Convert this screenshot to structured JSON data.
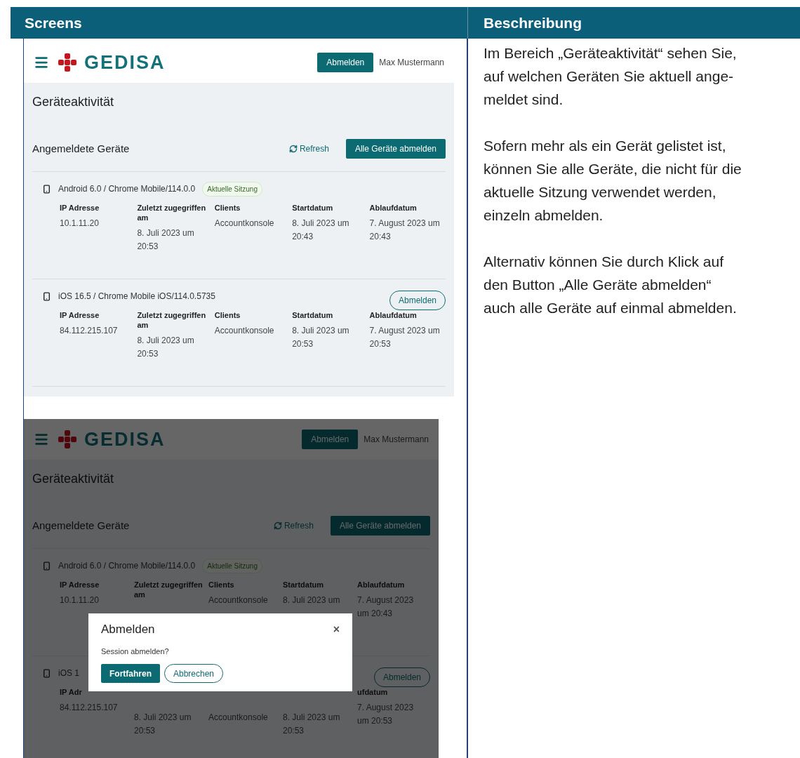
{
  "table": {
    "columns": [
      "Screens",
      "Beschreibung"
    ]
  },
  "screens": [
    {
      "dimmed": false,
      "logo": "GEDISA",
      "logout_button": "Abmelden",
      "user": "Max Mustermann",
      "page_title": "Geräteaktivität",
      "section_title": "Angemeldete Geräte",
      "refresh": "Refresh",
      "logout_all": "Alle Geräte abmelden",
      "devices": [
        {
          "name": "Android 6.0 / Chrome Mobile/114.0.0",
          "badge": "Aktuelle Sitzung",
          "cells": [
            {
              "label": "IP Adresse",
              "value": "10.1.11.20"
            },
            {
              "label": "Zuletzt zugegriffen am",
              "value": "8. Juli 2023 um 20:53"
            },
            {
              "label": "Clients",
              "value": "Accountkonsole"
            },
            {
              "label": "Startdatum",
              "value": "8. Juli 2023 um 20:43"
            },
            {
              "label": "Ablaufdatum",
              "value": "7. August 2023 um 20:43"
            }
          ]
        },
        {
          "name": "iOS 16.5 / Chrome Mobile iOS/114.0.5735",
          "logout_button": "Abmelden",
          "cells": [
            {
              "label": "IP Adresse",
              "value": "84.112.215.107"
            },
            {
              "label": "Zuletzt zugegriffen am",
              "value": "8. Juli 2023 um 20:53"
            },
            {
              "label": "Clients",
              "value": "Accountkonsole"
            },
            {
              "label": "Startdatum",
              "value": "8. Juli 2023 um 20:53"
            },
            {
              "label": "Ablaufdatum",
              "value": "7. August 2023 um 20:53"
            }
          ]
        }
      ]
    },
    {
      "dimmed": true,
      "logo": "GEDISA",
      "logout_button": "Abmelden",
      "user": "Max Mustermann",
      "page_title": "Geräteaktivität",
      "section_title": "Angemeldete Geräte",
      "refresh": "Refresh",
      "logout_all": "Alle Geräte abmelden",
      "devices": [
        {
          "name": "Android 6.0 / Chrome Mobile/114.0.0",
          "badge": "Aktuelle Sitzung",
          "cells": [
            {
              "label": "IP Adresse",
              "value": "10.1.11.20"
            },
            {
              "label": "Zuletzt zugegriffen am"
            },
            {
              "label": "Clients",
              "value": "Accountkonsole"
            },
            {
              "label": "Startdatum",
              "value": "8. Juli 2023 um"
            },
            {
              "label": "Ablaufdatum",
              "value": "7. August 2023 um 20:43"
            }
          ]
        },
        {
          "name": "iOS 1",
          "logout_button": "Abmelden",
          "cells": [
            {
              "label": "IP Adr",
              "value": "84.112.215.107"
            },
            {
              "value": "8. Juli 2023 um 20:53"
            },
            {
              "value": "Accountkonsole"
            },
            {
              "value": "8. Juli 2023 um 20:53"
            },
            {
              "label": "ufdatum",
              "value": "7. August 2023 um 20:53"
            }
          ]
        }
      ],
      "dialog": {
        "title": "Abmelden",
        "close": "×",
        "message": "Session abmelden?",
        "confirm": "Fortfahren",
        "cancel": "Abbrechen"
      }
    }
  ],
  "description": [
    "Im Bereich „Geräteaktivität“ sehen Sie,\nauf welchen Geräten Sie aktuell ange-\nmeldet sind.",
    "Sofern mehr als ein Gerät gelistet ist,\nkönnen Sie alle Geräte, die nicht für die\naktuelle Sitzung verwendet werden,\neinzeln abmelden.",
    "Alternativ können Sie durch Klick auf\nden Button „Alle Geräte abmelden“\nauch alle Geräte auf einmal abmelden."
  ]
}
